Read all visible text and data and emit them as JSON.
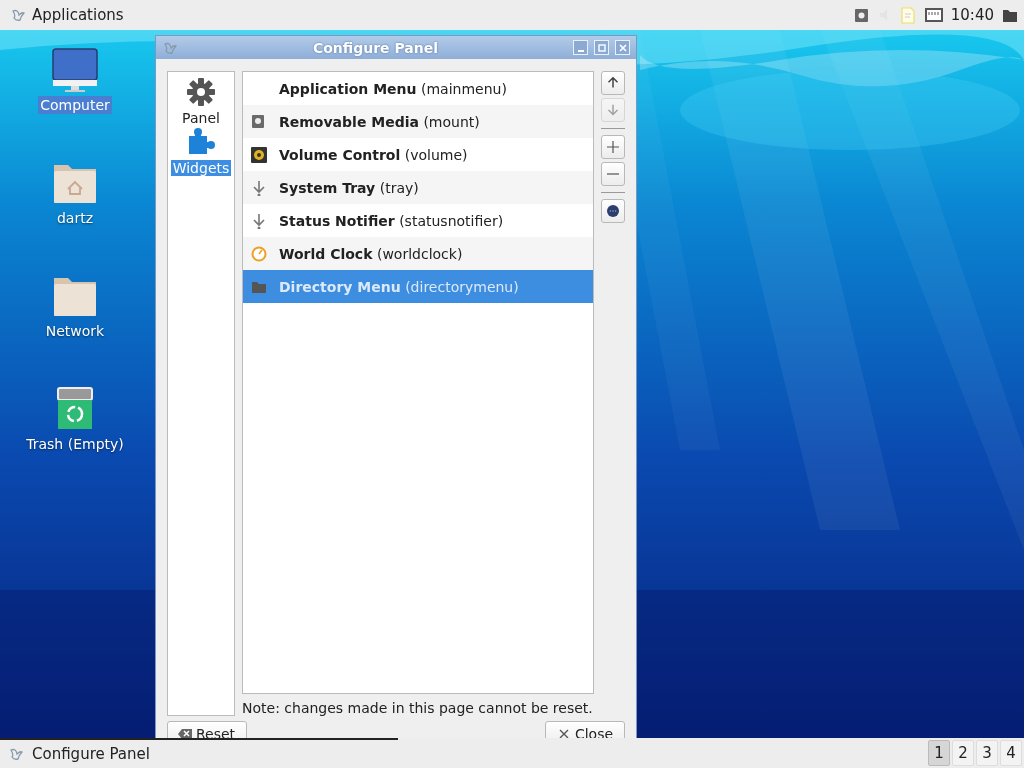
{
  "top_panel": {
    "menu_label": "Applications",
    "clock": "10:40"
  },
  "desktop_icons": [
    {
      "label": "Computer",
      "kind": "computer",
      "selected": true
    },
    {
      "label": "dartz",
      "kind": "home",
      "selected": false
    },
    {
      "label": "Network",
      "kind": "folder",
      "selected": false
    },
    {
      "label": "Trash (Empty)",
      "kind": "trash",
      "selected": false
    }
  ],
  "dialog": {
    "title": "Configure Panel",
    "sidebar": [
      {
        "label": "Panel",
        "kind": "gear",
        "selected": false
      },
      {
        "label": "Widgets",
        "kind": "puzzle",
        "selected": true
      }
    ],
    "widgets": [
      {
        "name": "Application Menu",
        "detail": "(mainmenu)",
        "kind": "none",
        "selected": false
      },
      {
        "name": "Removable Media",
        "detail": "(mount)",
        "kind": "drive",
        "selected": false
      },
      {
        "name": "Volume Control",
        "detail": "(volume)",
        "kind": "speaker",
        "selected": false
      },
      {
        "name": "System Tray",
        "detail": "(tray)",
        "kind": "arrow",
        "selected": false
      },
      {
        "name": "Status Notifier",
        "detail": "(statusnotifier)",
        "kind": "arrow",
        "selected": false
      },
      {
        "name": "World Clock",
        "detail": "(worldclock)",
        "kind": "clock",
        "selected": false
      },
      {
        "name": "Directory Menu",
        "detail": "(directorymenu)",
        "kind": "folder",
        "selected": true
      }
    ],
    "side_buttons": [
      {
        "kind": "up",
        "disabled": false
      },
      {
        "kind": "down",
        "disabled": true
      },
      {
        "kind": "add",
        "disabled": false
      },
      {
        "kind": "remove",
        "disabled": false
      },
      {
        "kind": "prefs",
        "disabled": false
      }
    ],
    "note": "Note: changes made in this page cannot be reset.",
    "buttons": [
      {
        "label": "Reset",
        "kind": "reset"
      },
      {
        "label": "Close",
        "kind": "close"
      }
    ]
  },
  "taskbar": {
    "tasks": [
      {
        "label": "Configure Panel",
        "selected": true
      }
    ],
    "workspaces": [
      {
        "label": "1",
        "selected": true
      },
      {
        "label": "2",
        "selected": false
      },
      {
        "label": "3",
        "selected": false
      },
      {
        "label": "4",
        "selected": false
      }
    ]
  }
}
